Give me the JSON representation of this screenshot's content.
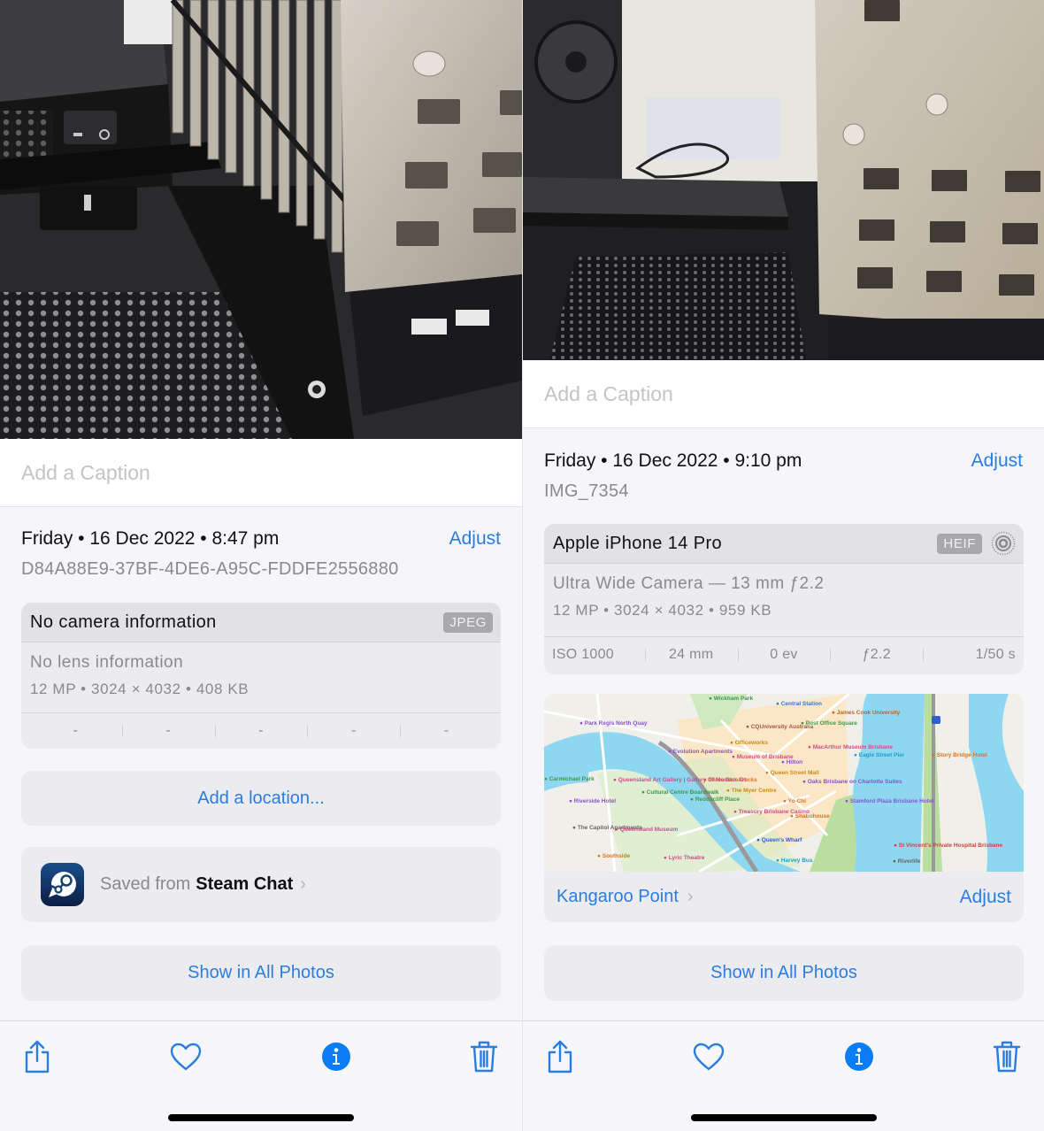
{
  "colors": {
    "accent": "#2a7de1",
    "info_fill": "#0a7cf5",
    "secondary_text": "#8a8a8e",
    "card_bg": "#ebebf0"
  },
  "left_panel": {
    "photo_alt": "Close-up of PC case interior with PSU and heatsink",
    "caption_placeholder": "Add a Caption",
    "date": "Friday • 16 Dec 2022 • 8:47 pm",
    "adjust_label": "Adjust",
    "filename": "D84A88E9-37BF-4DE6-A95C-FDDFE2556880",
    "camera": {
      "title": "No camera information",
      "format_badge": "JPEG",
      "lens": "No lens information",
      "specs": "12 MP  •  3024 × 4032  •  408 KB",
      "exif": [
        "-",
        "-",
        "-",
        "-",
        "-"
      ]
    },
    "add_location_label": "Add a location...",
    "source": {
      "prefix": "Saved from",
      "app": "Steam Chat",
      "icon": "steam-icon"
    },
    "show_all_label": "Show in All Photos",
    "toolbar": {
      "share": "share-icon",
      "favorite": "heart-icon",
      "info": "info-icon",
      "delete": "trash-icon"
    }
  },
  "right_panel": {
    "photo_alt": "PC case interior with fan and drive cage",
    "caption_placeholder": "Add a Caption",
    "date": "Friday • 16 Dec 2022 • 9:10 pm",
    "adjust_label": "Adjust",
    "filename": "IMG_7354",
    "camera": {
      "title": "Apple iPhone 14 Pro",
      "format_badge": "HEIF",
      "live_icon": "live-photo-icon",
      "lens": "Ultra Wide Camera — 13 mm ƒ2.2",
      "specs": "12 MP  •  3024 × 4032  •  959 KB",
      "exif": [
        "ISO 1000",
        "24 mm",
        "0 ev",
        "ƒ2.2",
        "1/50 s"
      ]
    },
    "map": {
      "labels": [
        {
          "text": "Wickham Park",
          "color": "#3a9a4a"
        },
        {
          "text": "Central Station",
          "color": "#2a7de1"
        },
        {
          "text": "James Cook University",
          "color": "#b5662e"
        },
        {
          "text": "Park Regis North Quay",
          "color": "#8a50d0"
        },
        {
          "text": "CQUniversity Australia",
          "color": "#9a5a3a"
        },
        {
          "text": "Post Office Square",
          "color": "#3a9a4a"
        },
        {
          "text": "Officeworks",
          "color": "#c88a10"
        },
        {
          "text": "Evolution Apartments",
          "color": "#8a50d0"
        },
        {
          "text": "Museum of Brisbane",
          "color": "#d04a8a"
        },
        {
          "text": "MacArthur Museum Brisbane",
          "color": "#d04a8a"
        },
        {
          "text": "Hilton",
          "color": "#8a50d0"
        },
        {
          "text": "Eagle Street Pier",
          "color": "#1aa0c8"
        },
        {
          "text": "Story Bridge Hotel",
          "color": "#e07020"
        },
        {
          "text": "Queen Street Mall",
          "color": "#c88a10"
        },
        {
          "text": "Three Blue Ducks",
          "color": "#e07020"
        },
        {
          "text": "Oaks Brisbane on Charlotte Suites",
          "color": "#8a50d0"
        },
        {
          "text": "Carmichael Park",
          "color": "#3a9a4a"
        },
        {
          "text": "Queensland Art Gallery | Gallery Of Modern Art",
          "color": "#d04a8a"
        },
        {
          "text": "Cultural Centre Boardwalk",
          "color": "#3a9a4a"
        },
        {
          "text": "The Myer Centre",
          "color": "#c88a10"
        },
        {
          "text": "Yo-Chi",
          "color": "#e07020"
        },
        {
          "text": "Riverside Hotel",
          "color": "#8a50d0"
        },
        {
          "text": "Reddacliff Place",
          "color": "#3a9a4a"
        },
        {
          "text": "Stamford Plaza Brisbane Hotel",
          "color": "#8a50d0"
        },
        {
          "text": "Treasury Brisbane Casino",
          "color": "#d04a8a"
        },
        {
          "text": "Shabuhouse",
          "color": "#e07020"
        },
        {
          "text": "The Capitol Apartments",
          "color": "#666666"
        },
        {
          "text": "Queensland Museum",
          "color": "#d04a8a"
        },
        {
          "text": "Queen's Wharf",
          "color": "#2a60d0"
        },
        {
          "text": "St Vincent's Private Hospital Brisbane",
          "color": "#d04040"
        },
        {
          "text": "Southside",
          "color": "#e07020"
        },
        {
          "text": "Lyric Theatre",
          "color": "#d04a8a"
        },
        {
          "text": "Harvey Bus",
          "color": "#1aa0c8"
        },
        {
          "text": "Riverlife",
          "color": "#666666"
        }
      ]
    },
    "place_label": "Kangaroo Point",
    "place_adjust_label": "Adjust",
    "show_all_label": "Show in All Photos",
    "toolbar": {
      "share": "share-icon",
      "favorite": "heart-icon",
      "info": "info-icon",
      "delete": "trash-icon"
    }
  }
}
